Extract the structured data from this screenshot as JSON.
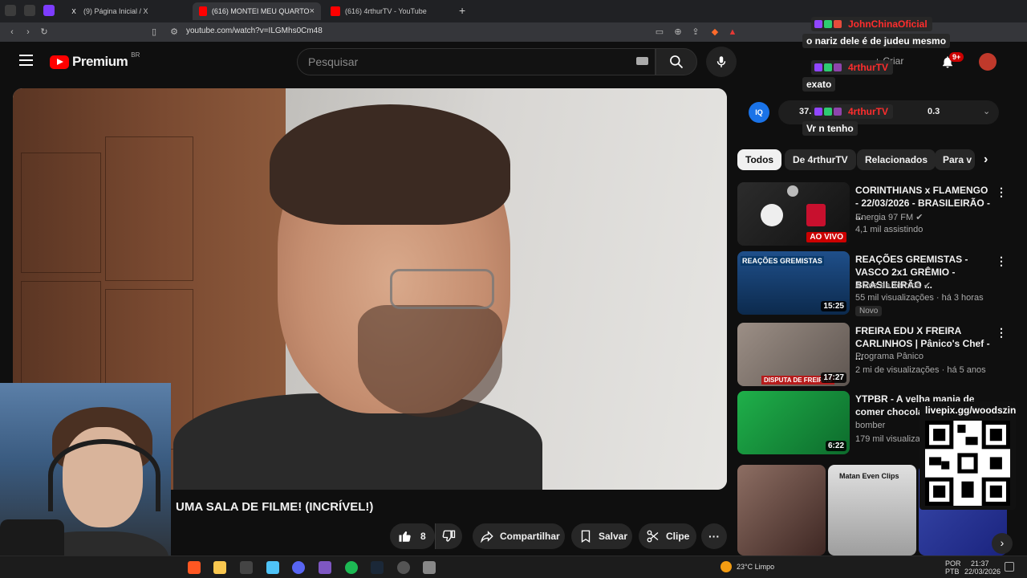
{
  "browser": {
    "tabs": [
      {
        "label": "(9) Página Inicial / X",
        "active": false
      },
      {
        "label": "(616) MONTEI MEU QUARTO",
        "active": true
      },
      {
        "label": "(616) 4rthurTV - YouTube",
        "active": false
      }
    ],
    "url": "youtube.com/watch?v=ILGMhs0Cm48"
  },
  "header": {
    "logo_text": "Premium",
    "region": "BR",
    "search_placeholder": "Pesquisar",
    "create_label": "Criar",
    "notif_count": "9+"
  },
  "chat": [
    {
      "user": "JohnChinaOficial",
      "message": "o nariz dele é de judeu mesmo"
    },
    {
      "user": "4rthurTV",
      "message": "exato"
    },
    {
      "user": "4rthurTV",
      "message": "Vr n tenho"
    }
  ],
  "iq_widget": {
    "icon": "IQ",
    "left_value": "37.",
    "right_value": "0.3"
  },
  "video": {
    "title": "UMA SALA DE FILME! (INCRÍVEL!)",
    "likes": "8",
    "share_label": "Compartilhar",
    "save_label": "Salvar",
    "clip_label": "Clipe"
  },
  "chips": [
    "Todos",
    "De 4rthurTV",
    "Relacionados",
    "Para v"
  ],
  "recommendations": [
    {
      "title": "CORINTHIANS x FLAMENGO - 22/03/2026 - BRASILEIRÃO - ...",
      "channel": "Energia 97 FM",
      "meta": "4,1 mil assistindo",
      "badge": "AO VIVO",
      "verified": true
    },
    {
      "title": "REAÇÕES GREMISTAS - VASCO 2x1 GRÊMIO - BRASILEIRÃO ...",
      "channel": "A Voz da Torcida",
      "meta": "55 mil visualizações · há 3 horas",
      "duration": "15:25",
      "new_label": "Novo",
      "verified": true
    },
    {
      "title": "FREIRA EDU X FREIRA CARLINHOS | Pânico's Chef - ...",
      "channel": "Programa Pânico",
      "meta": "2 mi de visualizações · há 5 anos",
      "duration": "17:27",
      "verified": false
    },
    {
      "title": "YTPBR - A velha mania de comer chocolat",
      "channel": "bomber",
      "meta": "179 mil visualiza",
      "duration": "6:22",
      "verified": false
    }
  ],
  "thumb_labels": {
    "gremio": "REAÇÕES GREMISTAS",
    "freiras": "DISPUTA DE FREIRAS",
    "short_label": "Matan Even Clips"
  },
  "qr": {
    "label": "livepix.gg/woodszin"
  },
  "taskbar": {
    "weather": "23°C  Limpo",
    "lang1": "POR",
    "lang2": "PTB",
    "time": "21:37",
    "date": "22/03/2026"
  },
  "colors": {
    "accent": "#ff0000",
    "bg": "#0f0f0f",
    "chip_bg": "#272727"
  }
}
